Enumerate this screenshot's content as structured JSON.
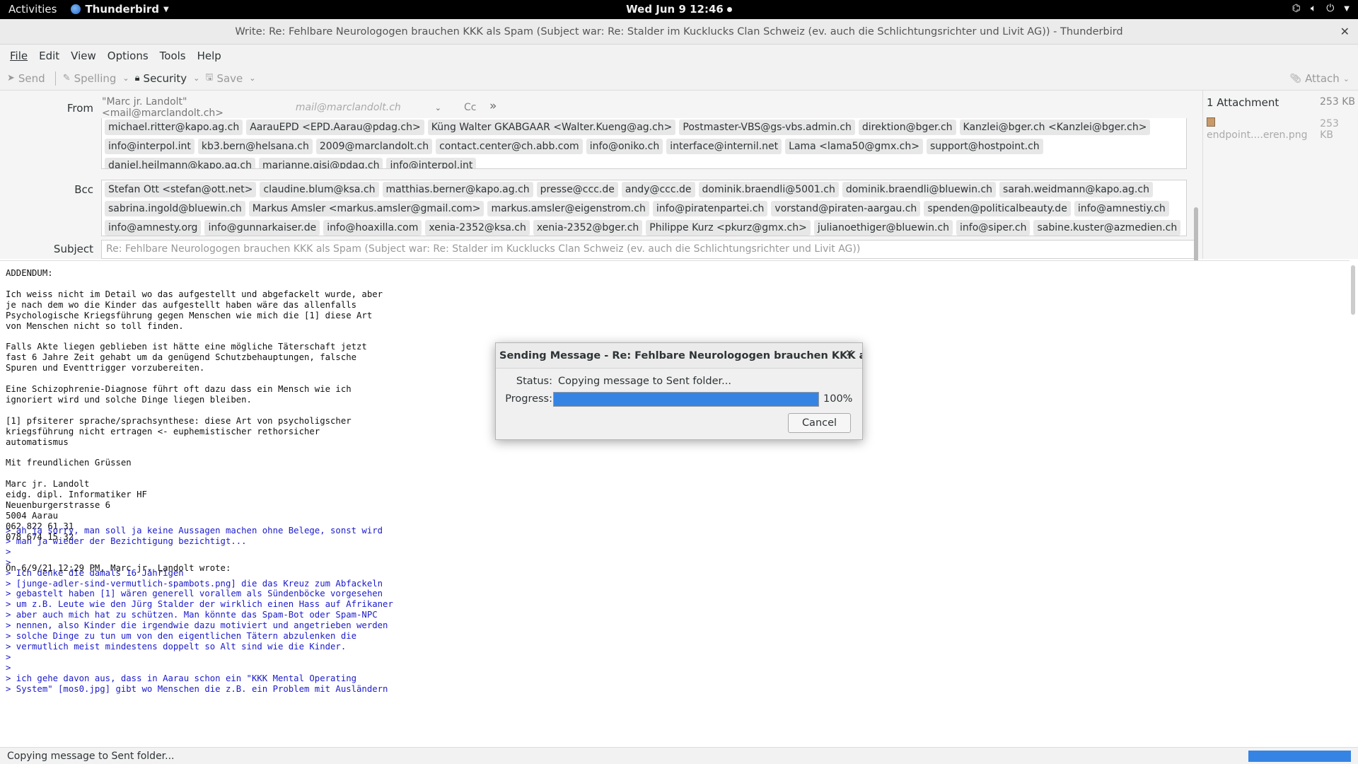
{
  "topbar": {
    "activities": "Activities",
    "app": "Thunderbird",
    "clock": "Wed Jun 9  12:46",
    "icons": [
      "network-icon",
      "volume-icon",
      "power-icon"
    ]
  },
  "window": {
    "title": "Write: Re: Fehlbare Neurologogen brauchen KKK als Spam (Subject war: Re: Stalder im Kucklucks Clan Schweiz (ev. auch die Schlichtungsrichter und Livit AG)) - Thunderbird"
  },
  "menu": [
    "File",
    "Edit",
    "View",
    "Options",
    "Tools",
    "Help"
  ],
  "toolbar": {
    "send": "Send",
    "spelling": "Spelling",
    "security": "Security",
    "save": "Save",
    "attach": "Attach"
  },
  "compose": {
    "from_label": "From",
    "from_value": "\"Marc jr. Landolt\" <mail@marclandolt.ch>",
    "from_identity": "mail@marclandolt.ch",
    "cc_label": "Cc",
    "bcc_label": "Bcc",
    "subject_label": "Subject",
    "subject": "Re: Fehlbare Neurologogen brauchen KKK als Spam (Subject war: Re: Stalder im Kucklucks Clan Schweiz (ev. auch die Schlichtungsrichter und Livit AG))",
    "to": [
      "michael.ritter@kapo.ag.ch",
      "AarauEPD <EPD.Aarau@pdag.ch>",
      "Küng Walter GKABGAAR <Walter.Kueng@ag.ch>",
      "Postmaster-VBS@gs-vbs.admin.ch",
      "direktion@bger.ch",
      "Kanzlei@bger.ch <Kanzlei@bger.ch>",
      "info@interpol.int",
      "kb3.bern@helsana.ch",
      "2009@marclandolt.ch",
      "contact.center@ch.abb.com",
      "info@oniko.ch",
      "interface@internil.net",
      "Lama <lama50@gmx.ch>",
      "support@hostpoint.ch",
      "daniel.heilmann@kapo.ag.ch",
      "marianne.gisi@pdag.ch",
      "info@interpol.int"
    ],
    "bcc": [
      "Stefan Ott <stefan@ott.net>",
      "claudine.blum@ksa.ch",
      "matthias.berner@kapo.ag.ch",
      "presse@ccc.de",
      "andy@ccc.de",
      "dominik.braendli@5001.ch",
      "dominik.braendli@bluewin.ch",
      "sarah.weidmann@kapo.ag.ch",
      "sabrina.ingold@bluewin.ch",
      "Markus Amsler <markus.amsler@gmail.com>",
      "markus.amsler@eigenstrom.ch",
      "info@piratenpartei.ch",
      "vorstand@piraten-aargau.ch",
      "spenden@politicalbeauty.de",
      "info@amnestiy.ch",
      "info@amnesty.org",
      "info@gunnarkaiser.de",
      "info@hoaxilla.com",
      "xenia-2352@ksa.ch",
      "xenia-2352@bger.ch",
      "Philippe Kurz <pkurz@gmx.ch>",
      "julianoethiger@bluewin.ch",
      "info@siper.ch",
      "sabine.kuster@azmedien.ch"
    ]
  },
  "attachments": {
    "header": "1 Attachment",
    "total_size": "253 KB",
    "items": [
      {
        "name": "endpoint....eren.png",
        "size": "253 KB"
      }
    ]
  },
  "body": {
    "text": "ADDENDUM:\n\nIch weiss nicht im Detail wo das aufgestellt und abgefackelt wurde, aber\nje nach dem wo die Kinder das aufgestellt haben wäre das allenfalls\nPsychologische Kriegsführung gegen Menschen wie mich die [1] diese Art\nvon Menschen nicht so toll finden.\n\nFalls Akte liegen geblieben ist hätte eine mögliche Täterschaft jetzt\nfast 6 Jahre Zeit gehabt um da genügend Schutzbehauptungen, falsche\nSpuren und Eventtrigger vorzubereiten.\n\nEine Schizophrenie-Diagnose führt oft dazu dass ein Mensch wie ich\nignoriert wird und solche Dinge liegen bleiben.\n\n[1] pfsiterer sprache/sprachsynthese: diese Art von psycholigscher\nkriegsführung nicht ertragen <- euphemistischer rethorsicher\nautomatismus\n\nMit freundlichen Grüssen\n\nMarc jr. Landolt\neidg. dipl. Informatiker HF\nNeuenburgerstrasse 6\n5004 Aarau\n062 822 61 31\n078 674 15 32\n\n\nOn 6/9/21 12:29 PM, Marc jr. Landolt wrote:",
    "quote": "> ah ja sorry, man soll ja keine Aussagen machen ohne Belege, sonst wird\n> man ja wieder der Bezichtigung bezichtigt...\n>\n>\n> Ich denke die damals 16 Jährigen\n> [junge-adler-sind-vermutlich-spambots.png] die das Kreuz zum Abfackeln\n> gebastelt haben [1] wären generell vorallem als Sündenböcke vorgesehen\n> um z.B. Leute wie den Jürg Stalder der wirklich einen Hass auf Afrikaner\n> aber auch mich hat zu schützen. Man könnte das Spam-Bot oder Spam-NPC\n> nennen, also Kinder die irgendwie dazu motiviert und angetrieben werden\n> solche Dinge zu tun um von den eigentlichen Tätern abzulenken die\n> vermutlich meist mindestens doppelt so Alt sind wie die Kinder.\n>\n>\n> ich gehe davon aus, dass in Aarau schon ein \"KKK Mental Operating\n> System\" [mos0.jpg] gibt wo Menschen die z.B. ein Problem mit Ausländern"
  },
  "dialog": {
    "title": "Sending Message - Re: Fehlbare Neurologogen brauchen KKK als Spam ...",
    "status_label": "Status:",
    "status": "Copying message to Sent folder...",
    "progress_label": "Progress:",
    "progress_value": 100,
    "progress_text": "100%",
    "cancel": "Cancel"
  },
  "statusbar": {
    "text": "Copying message to Sent folder..."
  },
  "colors": {
    "progress": "#3584e4",
    "quote_text": "#1a1acc"
  }
}
